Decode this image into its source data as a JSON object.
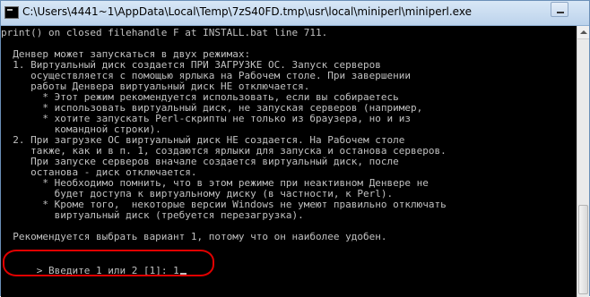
{
  "window": {
    "title": "C:\\Users\\4441~1\\AppData\\Local\\Temp\\7zS40FD.tmp\\usr\\local\\miniperl\\miniperl.exe"
  },
  "console": {
    "error_line": "print() on closed filehandle F at INSTALL.bat line 711.",
    "body_lines": [
      "  Денвер может запускаться в двух режимах:",
      "  1. Виртуальный диск создается ПРИ ЗАГРУЗКЕ ОС. Запуск серверов",
      "     осуществляется с помощью ярлыка на Рабочем столе. При завершении",
      "     работы Денвера виртуальный диск НЕ отключается.",
      "       * Этот режим рекомендуется использовать, если вы собираетесь",
      "       * использовать виртуальный диск, не запуская серверов (например,",
      "       * хотите запускать Perl-скрипты не только из браузера, но и из",
      "         командной строки).",
      "  2. При загрузке ОС виртуальный диск НЕ создается. На Рабочем столе",
      "     также, как и в п. 1, создаются ярлыки для запуска и останова серверов.",
      "     При запуске серверов вначале создается виртуальный диск, после",
      "     останова - диск отключается.",
      "       * Необходимо помнить, что в этом режиме при неактивном Денвере не",
      "         будет доступа к виртуальному диску (в частности, к Perl).",
      "       * Кроме того,  некоторые версии Windows не умеют правильно отключать",
      "         виртуальный диск (требуется перезагрузка).",
      "",
      "  Рекомендуется выбрать вариант 1, потому что он наиболее удобен.",
      ""
    ],
    "prompt": "> Введите 1 или 2 [1]: 1"
  }
}
